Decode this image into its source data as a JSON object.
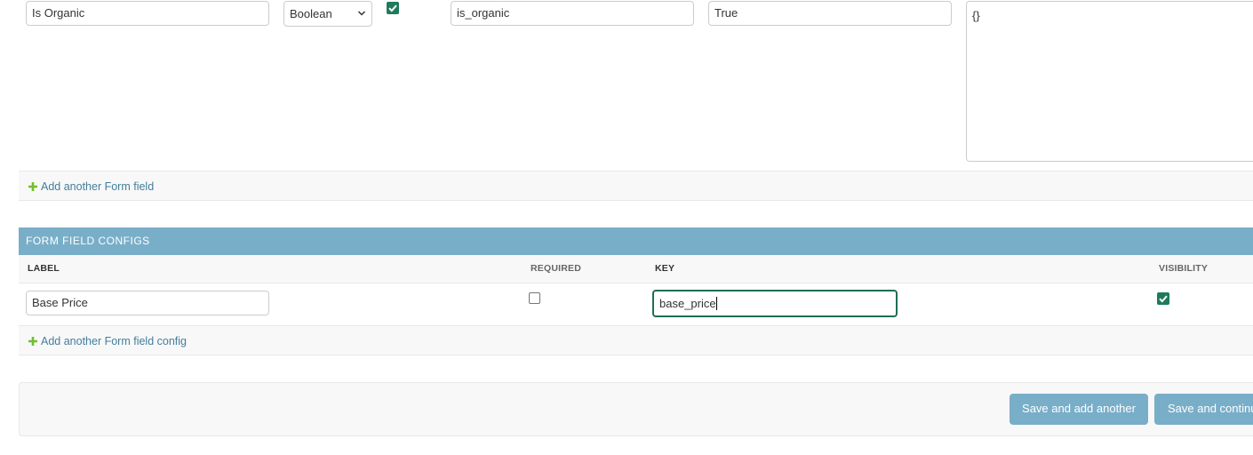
{
  "form_field_row": {
    "label_value": "Is Organic",
    "type_select": "Boolean",
    "required_checked": true,
    "key_value": "is_organic",
    "default_value": "True",
    "options_value": "{}"
  },
  "form_fields_add_link": "Add another Form field",
  "form_field_configs": {
    "header": "FORM FIELD CONFIGS",
    "columns": {
      "label": "LABEL",
      "required": "REQUIRED",
      "key": "KEY",
      "visibility": "VISIBILITY"
    },
    "row": {
      "label_value": "Base Price",
      "required_checked": false,
      "key_value": "base_price",
      "visibility_checked": true
    },
    "add_link": "Add another Form field config"
  },
  "submit": {
    "save_add_another": "Save and add another",
    "save_continue": "Save and continu"
  },
  "colors": {
    "module_header": "#79aec8",
    "link": "#447e9b",
    "plus_icon": "#70bf2b",
    "checkbox_checked": "#1e7b5a",
    "focus_border": "#1f6e55"
  }
}
